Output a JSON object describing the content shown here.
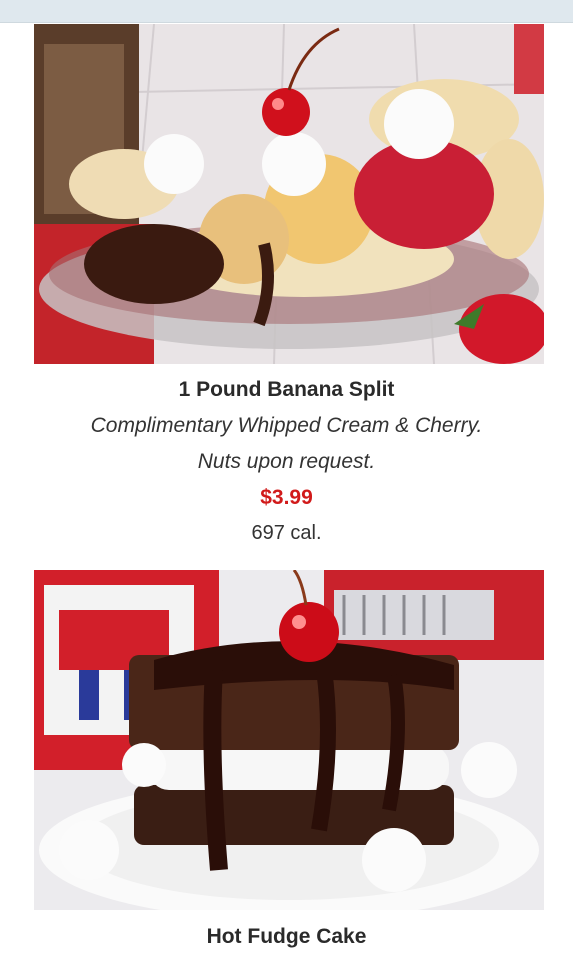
{
  "colors": {
    "price": "#d11a1a",
    "top_strip": "#dfe8ee"
  },
  "items": [
    {
      "name": "1 Pound Banana Split",
      "description_line1": "Complimentary Whipped Cream & Cherry.",
      "description_line2": "Nuts upon request.",
      "price": "$3.99",
      "calories": "697 cal.",
      "image": "banana-split-photo"
    },
    {
      "name": "Hot Fudge Cake",
      "image": "hot-fudge-cake-photo"
    }
  ]
}
